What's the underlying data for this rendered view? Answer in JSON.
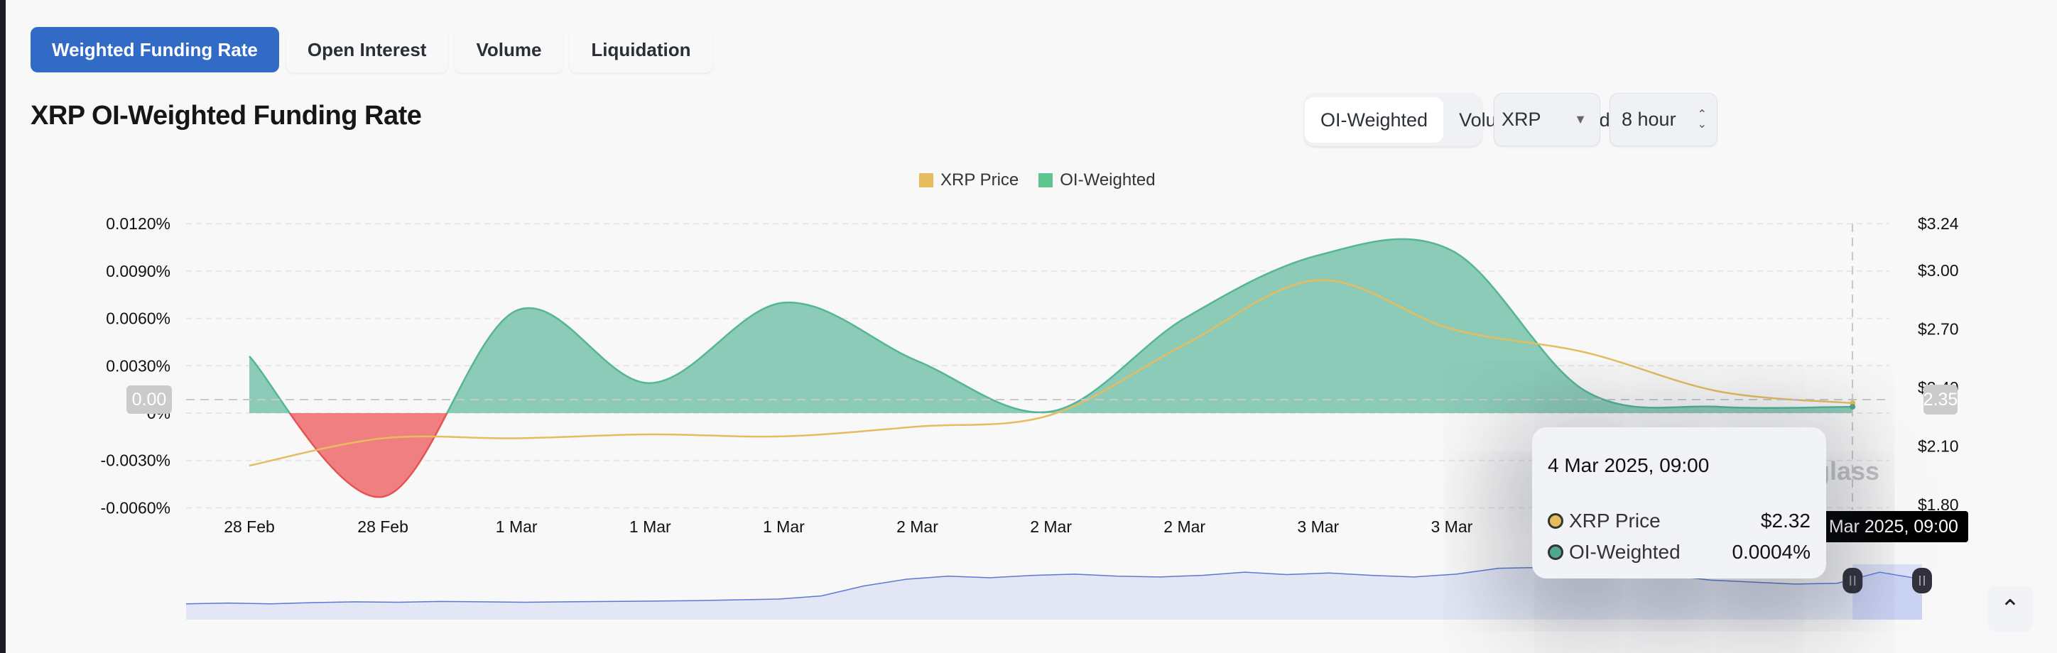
{
  "tabs": [
    {
      "label": "Weighted Funding Rate",
      "active": true
    },
    {
      "label": "Open Interest"
    },
    {
      "label": "Volume"
    },
    {
      "label": "Liquidation"
    }
  ],
  "title": "XRP OI-Weighted Funding Rate",
  "weighting": {
    "options": [
      "OI-Weighted",
      "Volume-Weighted"
    ],
    "selected": "OI-Weighted"
  },
  "coin_select": {
    "value": "XRP",
    "icon": "caret-down-icon"
  },
  "interval_select": {
    "value": "8 hour",
    "icon": "up-down-chevron-icon"
  },
  "watermark": "coinglass",
  "colors": {
    "accent": "#316bc6",
    "price": "#e5bd5f",
    "positive": "#5dc58d",
    "positive_fill": "#8ccbb8",
    "negative_fill": "#ef7f80",
    "negative": "#e55353",
    "navigator": "#5a78d6"
  },
  "crosshair": {
    "left_label": "0.00",
    "right_label": "2.35",
    "time_label": "4 Mar 2025, 09:00"
  },
  "tooltip": {
    "date": "4 Mar 2025, 09:00",
    "rows": [
      {
        "label": "XRP Price",
        "value": "$2.32",
        "color": "#e5bd5f"
      },
      {
        "label": "OI-Weighted",
        "value": "0.0004%",
        "color": "#4fa88e"
      }
    ]
  },
  "chart_data": {
    "type": "area",
    "legend": [
      "XRP Price",
      "OI-Weighted"
    ],
    "legend_placement": "top-center",
    "x": [
      "28 Feb 09:00",
      "28 Feb 17:00",
      "1 Mar 01:00",
      "1 Mar 09:00",
      "1 Mar 17:00",
      "2 Mar 01:00",
      "2 Mar 09:00",
      "2 Mar 17:00",
      "3 Mar 01:00",
      "3 Mar 09:00",
      "3 Mar 17:00",
      "4 Mar 01:00",
      "4 Mar 09:00"
    ],
    "x_tick_labels": [
      "28 Feb",
      "28 Feb",
      "1 Mar",
      "1 Mar",
      "1 Mar",
      "2 Mar",
      "2 Mar",
      "2 Mar",
      "3 Mar",
      "3 Mar"
    ],
    "y_left": {
      "ticks": [
        "0.0120%",
        "0.0090%",
        "0.0060%",
        "0.0030%",
        "0%",
        "-0.0030%",
        "-0.0060%"
      ],
      "range": [
        -0.006,
        0.012
      ],
      "unit": "%"
    },
    "y_right": {
      "ticks": [
        "$3.24",
        "$3.00",
        "$2.70",
        "$2.40",
        "$2.10",
        "$1.80"
      ],
      "range": [
        1.8,
        3.24
      ]
    },
    "grid": true,
    "series": [
      {
        "name": "OI-Weighted",
        "axis": "left",
        "values": [
          0.0036,
          -0.0053,
          0.0065,
          0.0019,
          0.007,
          0.0033,
          0.0001,
          0.006,
          0.01,
          0.0103,
          0.0014,
          0.0004,
          0.0004
        ]
      },
      {
        "name": "XRP Price",
        "axis": "right",
        "values": [
          2.0,
          2.14,
          2.14,
          2.16,
          2.15,
          2.2,
          2.26,
          2.62,
          2.95,
          2.7,
          2.58,
          2.38,
          2.32
        ]
      }
    ],
    "navigator": {
      "values": [
        1.0,
        1.02,
        1.0,
        1.03,
        1.05,
        1.04,
        1.06,
        1.05,
        1.04,
        1.05,
        1.06,
        1.07,
        1.08,
        1.1,
        1.12,
        1.2,
        1.45,
        1.62,
        1.7,
        1.66,
        1.72,
        1.75,
        1.7,
        1.68,
        1.72,
        1.8,
        1.74,
        1.78,
        1.72,
        1.68,
        1.75,
        1.9,
        1.92,
        1.85,
        1.78,
        1.72,
        1.6,
        1.55,
        1.5,
        1.52,
        1.8,
        1.62
      ],
      "selected_range": [
        0.96,
        1.0
      ]
    }
  }
}
